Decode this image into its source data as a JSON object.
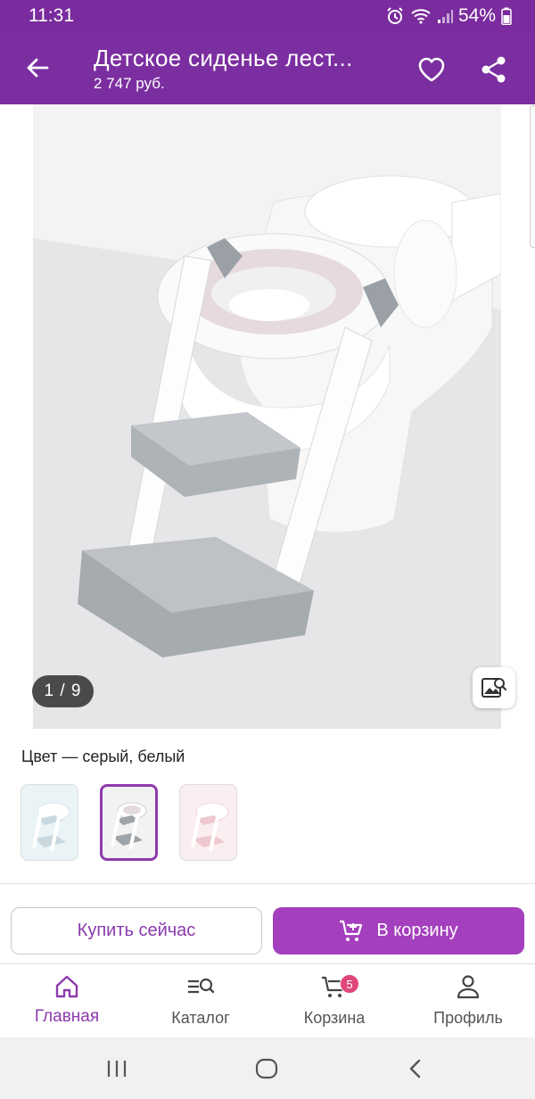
{
  "status_bar": {
    "time": "11:31",
    "battery": "54%"
  },
  "app_bar": {
    "title": "Детское сиденье лест...",
    "price": "2 747 руб."
  },
  "gallery": {
    "counter": "1 / 9"
  },
  "color_section": {
    "label": "Цвет — серый, белый"
  },
  "actions": {
    "buy_now": "Купить сейчас",
    "add_to_cart": "В корзину"
  },
  "bottom_nav": {
    "items": [
      {
        "label": "Главная",
        "icon": "home-icon",
        "active": true
      },
      {
        "label": "Каталог",
        "icon": "catalog-search-icon"
      },
      {
        "label": "Корзина",
        "icon": "cart-icon",
        "badge": "5"
      },
      {
        "label": "Профиль",
        "icon": "profile-icon"
      }
    ]
  },
  "colors": {
    "primary": "#7b2ea0",
    "accent_button": "#a43fbe",
    "badge": "#e0457b"
  }
}
